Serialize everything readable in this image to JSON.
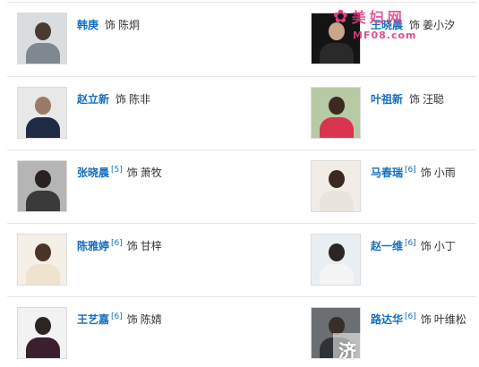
{
  "connector": "饰",
  "cast": [
    {
      "actor": "韩庚",
      "ref": "",
      "role": "陈炯",
      "icon": "actor-photo",
      "colors": {
        "bg": "#d9dde0",
        "head": "#4a3a30",
        "torso": "#7f8790"
      }
    },
    {
      "actor": "王晓晨",
      "ref": "",
      "role": "姜小汐",
      "icon": "actor-photo",
      "colors": {
        "bg": "#141414",
        "head": "#caa68a",
        "torso": "#2a2a2a"
      }
    },
    {
      "actor": "赵立新",
      "ref": "",
      "role": "陈非",
      "icon": "actor-photo",
      "colors": {
        "bg": "#e8e8e8",
        "head": "#9a7c66",
        "torso": "#1f2a44"
      }
    },
    {
      "actor": "叶祖新",
      "ref": "",
      "role": "汪聪",
      "icon": "actor-photo",
      "colors": {
        "bg": "#b7c9a5",
        "head": "#3b2a22",
        "torso": "#d9344f"
      }
    },
    {
      "actor": "张晓晨",
      "ref": "[5]",
      "role": "萧牧",
      "icon": "actor-photo",
      "colors": {
        "bg": "#b5b5b5",
        "head": "#2a2220",
        "torso": "#3a3a3a"
      }
    },
    {
      "actor": "马春瑞",
      "ref": "[6]",
      "role": "小雨",
      "icon": "actor-photo",
      "colors": {
        "bg": "#f1ede6",
        "head": "#3a2a22",
        "torso": "#e9e4dc"
      }
    },
    {
      "actor": "陈雅婷",
      "ref": "[6]",
      "role": "甘梓",
      "icon": "actor-photo",
      "colors": {
        "bg": "#f5efe7",
        "head": "#4a3426",
        "torso": "#efe3d0"
      }
    },
    {
      "actor": "赵一维",
      "ref": "[6]",
      "role": "小丁",
      "icon": "actor-photo",
      "colors": {
        "bg": "#e9eef2",
        "head": "#2b2623",
        "torso": "#f4f4f4"
      }
    },
    {
      "actor": "王艺嘉",
      "ref": "[6]",
      "role": "陈婧",
      "icon": "actor-photo",
      "colors": {
        "bg": "#f2f2f2",
        "head": "#2c2420",
        "torso": "#3b1f2e"
      }
    },
    {
      "actor": "路达华",
      "ref": "[6]",
      "role": "叶维松",
      "icon": "actor-photo",
      "colors": {
        "bg": "#6b6f72",
        "head": "#3a2e28",
        "torso": "#2f3338"
      }
    }
  ],
  "watermark_top": {
    "mark": "✿",
    "name": "美妇网",
    "domain": "MF08.com",
    "color": "#e23a85"
  },
  "watermark_bottom": {
    "text": "济"
  }
}
